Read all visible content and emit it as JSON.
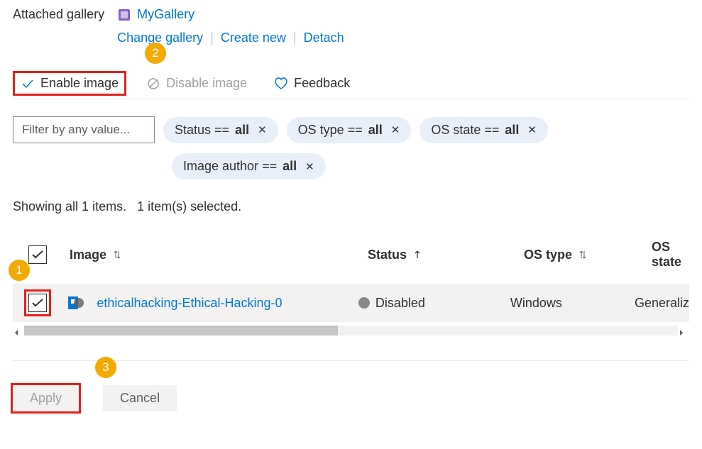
{
  "header": {
    "attached_label": "Attached gallery",
    "gallery_name": "MyGallery",
    "actions": {
      "change": "Change gallery",
      "create": "Create new",
      "detach": "Detach"
    }
  },
  "toolbar": {
    "enable_label": "Enable image",
    "disable_label": "Disable image",
    "feedback_label": "Feedback"
  },
  "filters": {
    "placeholder": "Filter by any value...",
    "pills": {
      "status": {
        "label": "Status == ",
        "value": "all"
      },
      "ostype": {
        "label": "OS type == ",
        "value": "all"
      },
      "osstate": {
        "label": "OS state == ",
        "value": "all"
      },
      "author": {
        "label": "Image author == ",
        "value": "all"
      }
    }
  },
  "status": {
    "showing": "Showing all 1 items.",
    "selected": "1 item(s) selected."
  },
  "table": {
    "headers": {
      "image": "Image",
      "status": "Status",
      "ostype": "OS type",
      "osstate": "OS state"
    },
    "rows": [
      {
        "name": "ethicalhacking-Ethical-Hacking-0",
        "status": "Disabled",
        "ostype": "Windows",
        "osstate": "Generaliz"
      }
    ]
  },
  "footer": {
    "apply": "Apply",
    "cancel": "Cancel"
  },
  "annotations": {
    "b1": "1",
    "b2": "2",
    "b3": "3"
  }
}
